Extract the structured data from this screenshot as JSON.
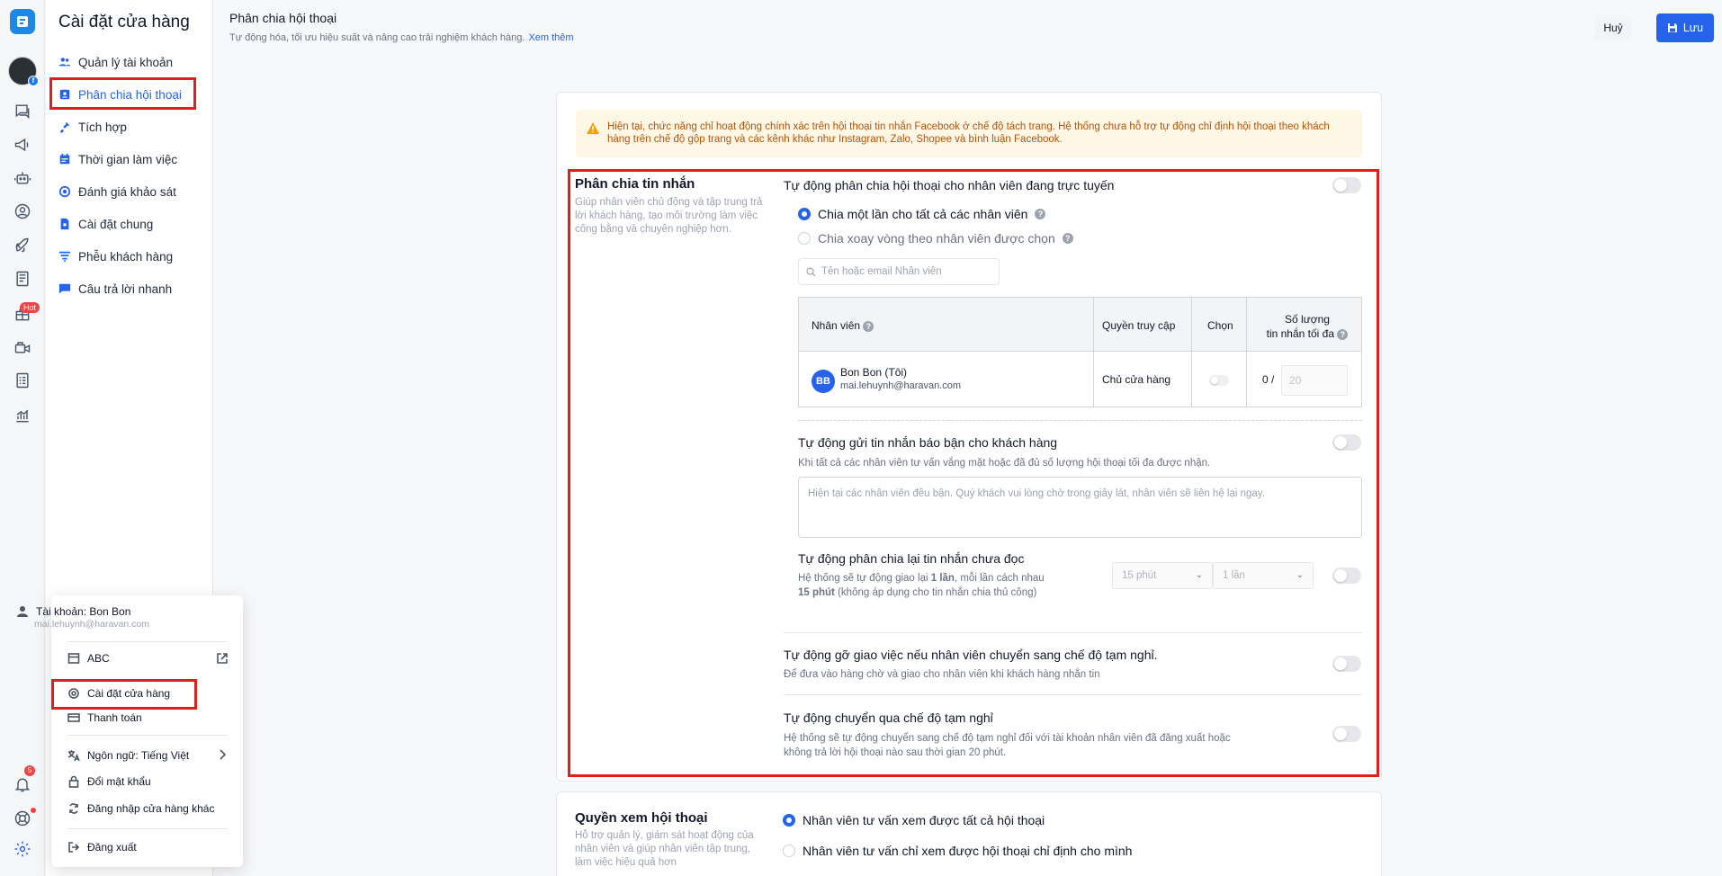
{
  "sidebar": {
    "title": "Cài đặt cửa hàng",
    "items": [
      {
        "label": "Quản lý tài khoản"
      },
      {
        "label": "Phân chia hội thoại"
      },
      {
        "label": "Tích hợp"
      },
      {
        "label": "Thời gian làm việc"
      },
      {
        "label": "Đánh giá khảo sát"
      },
      {
        "label": "Cài đặt chung"
      },
      {
        "label": "Phễu khách hàng"
      },
      {
        "label": "Câu trả lời nhanh"
      }
    ]
  },
  "rail": {
    "hot_badge": "Hot",
    "notification_count": "5",
    "icons": [
      "chat-icon",
      "megaphone-icon",
      "robot-icon",
      "contact-icon",
      "rocket-icon",
      "news-icon",
      "gift-icon",
      "video-icon",
      "report-icon",
      "chart-icon",
      "bell-icon",
      "support-icon",
      "gear-icon"
    ]
  },
  "header": {
    "title": "Phân chia hội thoại",
    "subtitle": "Tự động hóa, tối ưu hiệu suất và nâng cao trải nghiệm khách hàng.",
    "more_link": "Xem thêm",
    "cancel_label": "Huỷ",
    "save_label": "Lưu"
  },
  "warning": "Hiện tại, chức năng chỉ hoạt động chính xác trên hội thoại tin nhắn Facebook ở chế độ tách trang. Hệ thống chưa hỗ trợ tự động chỉ định hội thoại theo khách hàng trên chế độ gộp trang và các kênh khác như Instagram, Zalo, Shopee và bình luận Facebook.",
  "distribution": {
    "title": "Phân chia tin nhắn",
    "desc": "Giúp nhân viên chủ động và tập trung trả lời khách hàng, tạo môi trường làm việc công bằng và chuyên nghiệp hơn.",
    "auto_online_title": "Tự động phân chia hội thoại cho nhân viên đang trực tuyến",
    "option_once": "Chia một lần cho tất cả các nhân viên",
    "option_round": "Chia xoay vòng theo nhân viên được chọn",
    "search_placeholder": "Tên hoặc email Nhân viên",
    "table": {
      "headers": {
        "staff": "Nhân viên",
        "access": "Quyền truy cập",
        "select": "Chọn",
        "max_line1": "Số lượng",
        "max_line2": "tin nhắn tối đa"
      },
      "rows": [
        {
          "initials": "BB",
          "name": "Bon Bon (Tôi)",
          "email": "mai.lehuynh@haravan.com",
          "role": "Chủ cửa hàng",
          "count": "0 /",
          "max_placeholder": "20"
        }
      ]
    },
    "busy_title": "Tự động gửi tin nhắn báo bận cho khách hàng",
    "busy_desc": "Khi tất cả các nhân viên tư vấn vắng mặt hoặc đã đủ số lượng hội thoại tối đa được nhận.",
    "busy_message": "Hiện tại các nhân viên đều bận. Quý khách vui lòng chờ trong giây lát, nhân viên sẽ liên hệ lại ngay.",
    "redistribute_title": "Tự động phân chia lại tin nhắn chưa đọc",
    "redistribute_desc_1": "Hệ thống sẽ tự động giao lại",
    "redistribute_times_bold": "1 lần",
    "redistribute_desc_2": ", mỗi lần cách nhau",
    "redistribute_interval_bold": "15 phút",
    "redistribute_desc_3": "(không áp dụng cho tin nhắn chia thủ công)",
    "interval_select": "15 phút",
    "times_select": "1 lần",
    "unassign_title": "Tự động gỡ giao việc nếu nhân viên chuyển sang chế độ tạm nghỉ.",
    "unassign_desc": "Để đưa vào hàng chờ và giao cho nhân viên khi khách hàng nhắn tin",
    "away_title": "Tự động chuyển qua chế độ tạm nghỉ",
    "away_desc": "Hệ thống sẽ tự động chuyển sang chế độ tạm nghỉ đối với tài khoản nhân viên đã đăng xuất hoặc không trả lời hội thoại nào sau thời gian 20 phút."
  },
  "view_rights": {
    "title": "Quyền xem hội thoại",
    "desc": "Hỗ trợ quản lý, giám sát hoạt động của nhân viên và giúp nhân viên tập trung, làm việc hiệu quả hơn",
    "option_all": "Nhân viên tư vấn xem được tất cả hội thoại",
    "option_assigned": "Nhân viên tư vấn chỉ xem được hội thoại chỉ định cho mình"
  },
  "account_menu": {
    "account_label": "Tài khoản: Bon Bon",
    "account_email": "mai.lehuynh@haravan.com",
    "store": "ABC",
    "store_settings": "Cài đặt cửa hàng",
    "billing": "Thanh toán",
    "language": "Ngôn ngữ: Tiếng Việt",
    "change_password": "Đổi mật khẩu",
    "switch_store": "Đăng nhập cửa hàng khác",
    "logout": "Đăng xuất"
  },
  "colors": {
    "accent": "#2563eb",
    "highlight": "#e11d1d",
    "warning_bg": "#fff7e6",
    "warning_text": "#b45309"
  }
}
